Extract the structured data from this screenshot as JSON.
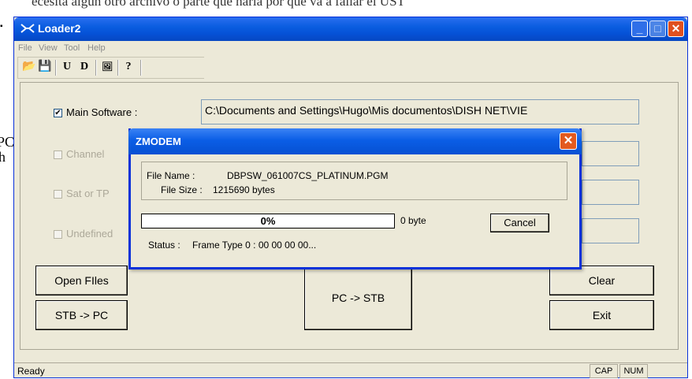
{
  "background": {
    "top_line": "ecesita algún otro archivo o parte que haría por qué va a fallar el UST",
    "left_frag_1": "PC",
    "left_frag_2": "h"
  },
  "window": {
    "title": "Loader2",
    "menu": [
      "File",
      "View",
      "Tool",
      "Help"
    ],
    "toolbar_icons": [
      "open-folder-icon",
      "save-icon",
      "u-icon",
      "d-icon",
      "image-icon",
      "help-icon"
    ],
    "toolbar_glyphs": [
      "📂",
      "💾",
      "U",
      "D",
      "🖼",
      "?"
    ]
  },
  "form": {
    "rows": [
      {
        "checked": true,
        "enabled": true,
        "label": "Main Software :",
        "path": "C:\\Documents and Settings\\Hugo\\Mis documentos\\DISH NET\\VIE"
      },
      {
        "checked": false,
        "enabled": false,
        "label": "Channel",
        "path": ""
      },
      {
        "checked": false,
        "enabled": false,
        "label": "Sat or TP",
        "path": ""
      },
      {
        "checked": false,
        "enabled": false,
        "label": "Undefined",
        "path": ""
      }
    ],
    "check_mark": "✔"
  },
  "buttons": {
    "open_files": "Open FIles",
    "stb_to_pc": "STB -> PC",
    "pc_to_stb": "PC -> STB",
    "clear": "Clear",
    "exit": "Exit"
  },
  "statusbar": {
    "text": "Ready",
    "cap": "CAP",
    "num": "NUM"
  },
  "dialog": {
    "title": "ZMODEM",
    "close_glyph": "✕",
    "file_name_label": "File Name :",
    "file_name": "DBPSW_061007CS_PLATINUM.PGM",
    "file_size_label": "File Size :",
    "file_size": "1215690 bytes",
    "progress_text": "0%",
    "progress_value": 0,
    "transferred": "0 byte",
    "cancel": "Cancel",
    "status_label": "Status :",
    "status_text": "Frame Type 0 : 00 00 00 00..."
  },
  "colors": {
    "titlebar": "#0a5de0",
    "window_bg": "#ece9d8",
    "close_red": "#e0501f"
  }
}
